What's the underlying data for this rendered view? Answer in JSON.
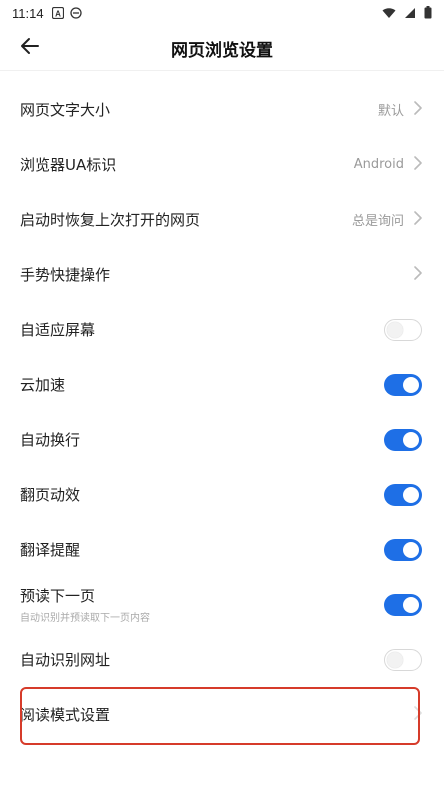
{
  "status_bar": {
    "time": "11:14",
    "icons": [
      "a-badge-icon",
      "sync-icon"
    ],
    "right_icons": [
      "wifi-icon",
      "signal-icon",
      "battery-icon"
    ]
  },
  "header": {
    "title": "网页浏览设置",
    "back_icon": "back-arrow-icon"
  },
  "settings": [
    {
      "label": "网页文字大小",
      "value": "默认",
      "control": "chevron"
    },
    {
      "label": "浏览器UA标识",
      "value": "Android",
      "control": "chevron"
    },
    {
      "label": "启动时恢复上次打开的网页",
      "value": "总是询问",
      "control": "chevron"
    },
    {
      "label": "手势快捷操作",
      "value": "",
      "control": "chevron"
    },
    {
      "label": "自适应屏幕",
      "control": "toggle",
      "on": false
    },
    {
      "label": "云加速",
      "control": "toggle",
      "on": true
    },
    {
      "label": "自动换行",
      "control": "toggle",
      "on": true
    },
    {
      "label": "翻页动效",
      "control": "toggle",
      "on": true
    },
    {
      "label": "翻译提醒",
      "control": "toggle",
      "on": true
    },
    {
      "label": "预读下一页",
      "sublabel": "自动识别并预读取下一页内容",
      "control": "toggle",
      "on": true
    },
    {
      "label": "自动识别网址",
      "control": "toggle",
      "on": false
    },
    {
      "label": "阅读模式设置",
      "control": "chevron"
    }
  ],
  "colors": {
    "accent": "#1e6fe6",
    "highlight": "#d63b2a",
    "secondary_text": "#9a9a9a"
  }
}
